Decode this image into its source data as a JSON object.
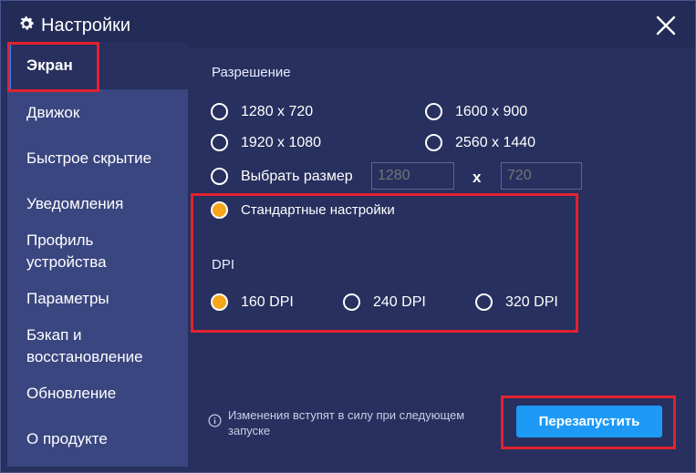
{
  "window": {
    "title": "Настройки",
    "icons": {
      "title": "gear-icon",
      "close": "close-icon",
      "info": "info-icon"
    }
  },
  "sidebar": {
    "items": [
      {
        "label": "Экран",
        "active": true
      },
      {
        "label": "Движок"
      },
      {
        "label": "Быстрое скрытие"
      },
      {
        "label": "Уведомления"
      },
      {
        "label": "Профиль устройства"
      },
      {
        "label": "Параметры"
      },
      {
        "label": "Бэкап и восстановление"
      },
      {
        "label": "Обновление"
      },
      {
        "label": "О продукте"
      }
    ]
  },
  "resolution": {
    "label": "Разрешение",
    "options": [
      {
        "label": "1280 x 720",
        "selected": false
      },
      {
        "label": "1600 x 900",
        "selected": false
      },
      {
        "label": "1920 x 1080",
        "selected": false
      },
      {
        "label": "2560 x 1440",
        "selected": false
      },
      {
        "label": "Выбрать размер",
        "selected": false
      }
    ],
    "custom_width_placeholder": "1280",
    "custom_height_placeholder": "720",
    "times_symbol": "x"
  },
  "standard": {
    "label": "Стандартные настройки",
    "selected": true
  },
  "dpi": {
    "label": "DPI",
    "options": [
      {
        "label": "160 DPI",
        "selected": true
      },
      {
        "label": "240 DPI",
        "selected": false
      },
      {
        "label": "320 DPI",
        "selected": false
      }
    ]
  },
  "footer": {
    "info_text": "Изменения вступят в силу при следующем запуске",
    "restart_label": "Перезапустить"
  },
  "colors": {
    "accent": "#1e9af6",
    "radio_selected": "#f7a51a",
    "highlight": "#e3222e",
    "sidebar_bg": "#3a4680",
    "window_bg": "#27305e"
  }
}
